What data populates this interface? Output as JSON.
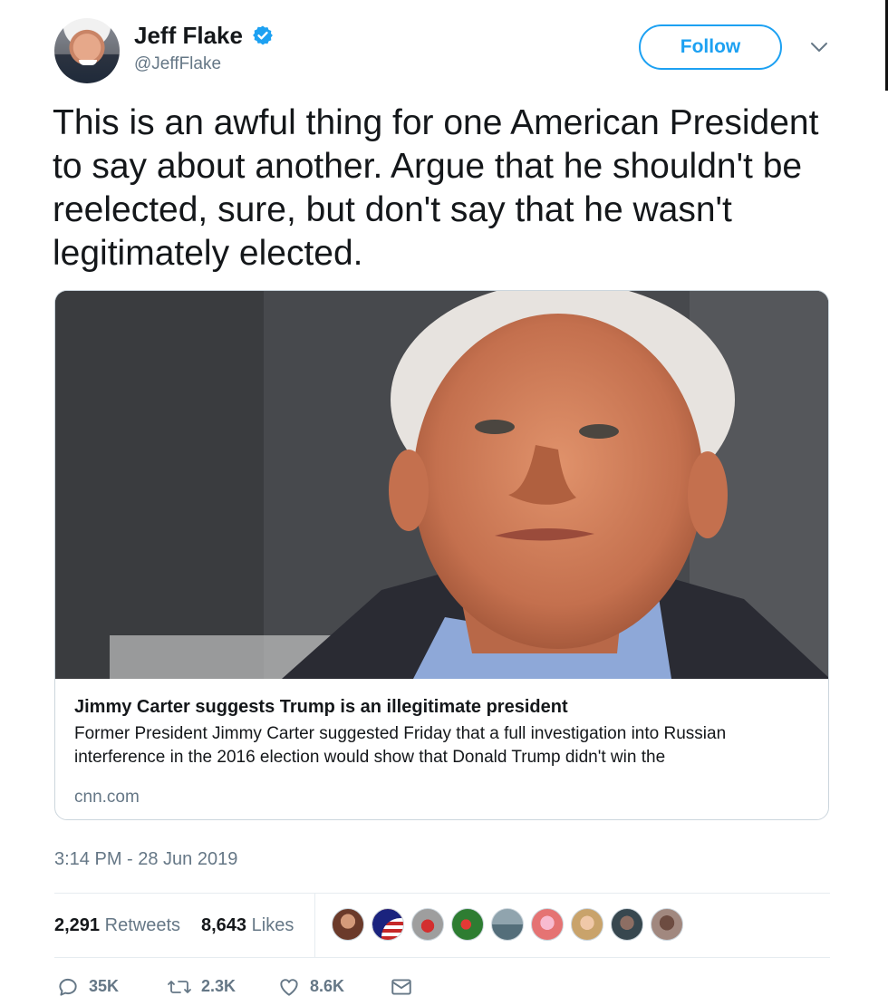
{
  "author": {
    "display_name": "Jeff Flake",
    "handle": "@JeffFlake",
    "verified": true
  },
  "header": {
    "follow_label": "Follow"
  },
  "tweet": {
    "text": "This is an awful thing for one American President to say about another. Argue that he shouldn't be reelected, sure, but don't say that he wasn't legitimately elected.",
    "timestamp": "3:14 PM - 28 Jun 2019"
  },
  "card": {
    "title": "Jimmy Carter suggests Trump is an illegitimate president",
    "description": "Former President Jimmy Carter suggested Friday that a full investigation into Russian interference in the 2016 election would show that Donald Trump didn't win the",
    "domain": "cnn.com"
  },
  "stats": {
    "retweets_count": "2,291",
    "retweets_label": "Retweets",
    "likes_count": "8,643",
    "likes_label": "Likes"
  },
  "actions": {
    "replies": "35K",
    "retweets": "2.3K",
    "likes": "8.6K"
  },
  "colors": {
    "accent": "#1da1f2",
    "muted_text": "#657786",
    "border": "#e6ecf0"
  },
  "icons": [
    "verified-badge-icon",
    "chevron-down-icon",
    "reply-icon",
    "retweet-icon",
    "heart-icon",
    "direct-message-icon"
  ]
}
